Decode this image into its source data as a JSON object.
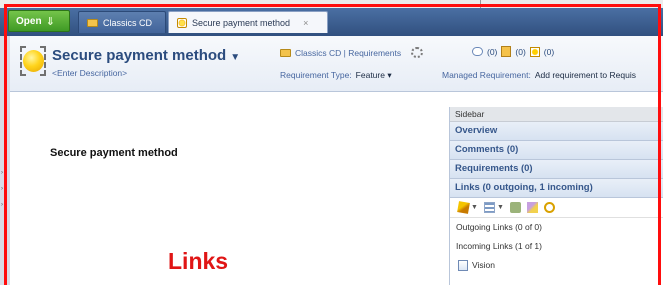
{
  "tabbar": {
    "open_label": "Open",
    "tabs": [
      {
        "label": "Classics CD",
        "active": false
      },
      {
        "label": "Secure payment method",
        "active": true
      }
    ]
  },
  "header": {
    "title": "Secure payment method",
    "description": "<Enter Description>",
    "breadcrumb": "Classics CD | Requirements",
    "counts": [
      "(0)",
      "(0)",
      "(0)"
    ],
    "requirement_type_label": "Requirement Type:",
    "requirement_type_value": "Feature",
    "managed_label": "Managed Requirement:",
    "managed_value": "Add requirement to Requis"
  },
  "content": {
    "text": "Secure payment method"
  },
  "sidebar": {
    "title": "Sidebar",
    "sections": [
      "Overview",
      "Comments (0)",
      "Requirements (0)",
      "Links (0 outgoing, 1 incoming)"
    ],
    "outgoing": "Outgoing Links (0 of 0)",
    "incoming": "Incoming Links (1 of 1)",
    "link_item": "Vision"
  },
  "annotation": "Links",
  "colors": {
    "frame": "#ff0d0d",
    "tabbar": "#3d5e90",
    "accent": "#2b4c7e"
  }
}
